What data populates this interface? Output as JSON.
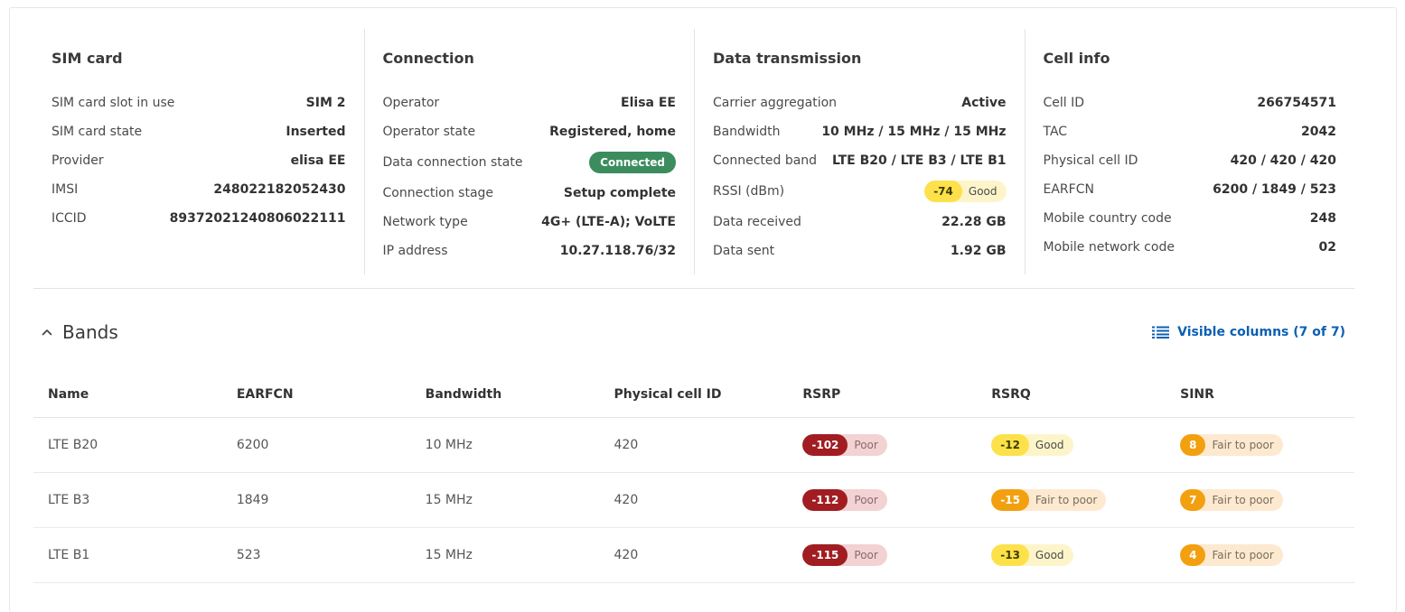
{
  "sim_card": {
    "title": "SIM card",
    "rows": [
      {
        "label": "SIM card slot in use",
        "value": "SIM 2"
      },
      {
        "label": "SIM card state",
        "value": "Inserted"
      },
      {
        "label": "Provider",
        "value": "elisa EE"
      },
      {
        "label": "IMSI",
        "value": "248022182052430"
      },
      {
        "label": "ICCID",
        "value": "89372021240806022111"
      }
    ]
  },
  "connection": {
    "title": "Connection",
    "rows": [
      {
        "label": "Operator",
        "value": "Elisa EE"
      },
      {
        "label": "Operator state",
        "value": "Registered, home"
      },
      {
        "label": "Data connection state",
        "value": "Connected"
      },
      {
        "label": "Connection stage",
        "value": "Setup complete"
      },
      {
        "label": "Network type",
        "value": "4G+ (LTE-A); VoLTE"
      },
      {
        "label": "IP address",
        "value": "10.27.118.76/32"
      }
    ]
  },
  "data_transmission": {
    "title": "Data transmission",
    "rows": [
      {
        "label": "Carrier aggregation",
        "value": "Active"
      },
      {
        "label": "Bandwidth",
        "value": "10 MHz / 15 MHz / 15 MHz"
      },
      {
        "label": "Connected band",
        "value": "LTE B20 / LTE B3 / LTE B1"
      },
      {
        "label": "RSSI (dBm)",
        "value": "-74",
        "quality": "Good"
      },
      {
        "label": "Data received",
        "value": "22.28 GB"
      },
      {
        "label": "Data sent",
        "value": "1.92 GB"
      }
    ]
  },
  "cell_info": {
    "title": "Cell info",
    "rows": [
      {
        "label": "Cell ID",
        "value": "266754571"
      },
      {
        "label": "TAC",
        "value": "2042"
      },
      {
        "label": "Physical cell ID",
        "value": "420 / 420 / 420"
      },
      {
        "label": "EARFCN",
        "value": "6200 / 1849 / 523"
      },
      {
        "label": "Mobile country code",
        "value": "248"
      },
      {
        "label": "Mobile network code",
        "value": "02"
      }
    ]
  },
  "bands": {
    "title": "Bands",
    "visible_columns_label": "Visible columns (7 of 7)",
    "columns": [
      "Name",
      "EARFCN",
      "Bandwidth",
      "Physical cell ID",
      "RSRP",
      "RSRQ",
      "SINR"
    ],
    "rows": [
      {
        "name": "LTE B20",
        "earfcn": "6200",
        "bandwidth": "10 MHz",
        "pci": "420",
        "rsrp": {
          "value": "-102",
          "quality": "Poor"
        },
        "rsrq": {
          "value": "-12",
          "quality": "Good"
        },
        "sinr": {
          "value": "8",
          "quality": "Fair to poor"
        }
      },
      {
        "name": "LTE B3",
        "earfcn": "1849",
        "bandwidth": "15 MHz",
        "pci": "420",
        "rsrp": {
          "value": "-112",
          "quality": "Poor"
        },
        "rsrq": {
          "value": "-15",
          "quality": "Fair to poor"
        },
        "sinr": {
          "value": "7",
          "quality": "Fair to poor"
        }
      },
      {
        "name": "LTE B1",
        "earfcn": "523",
        "bandwidth": "15 MHz",
        "pci": "420",
        "rsrp": {
          "value": "-115",
          "quality": "Poor"
        },
        "rsrq": {
          "value": "-13",
          "quality": "Good"
        },
        "sinr": {
          "value": "4",
          "quality": "Fair to poor"
        }
      }
    ]
  },
  "colors": {
    "connected_green": "#3b8d5e",
    "good_yellow": "#fde14a",
    "fair_orange": "#f2a00f",
    "poor_red": "#a11d22",
    "link_blue": "#0a60b3"
  }
}
